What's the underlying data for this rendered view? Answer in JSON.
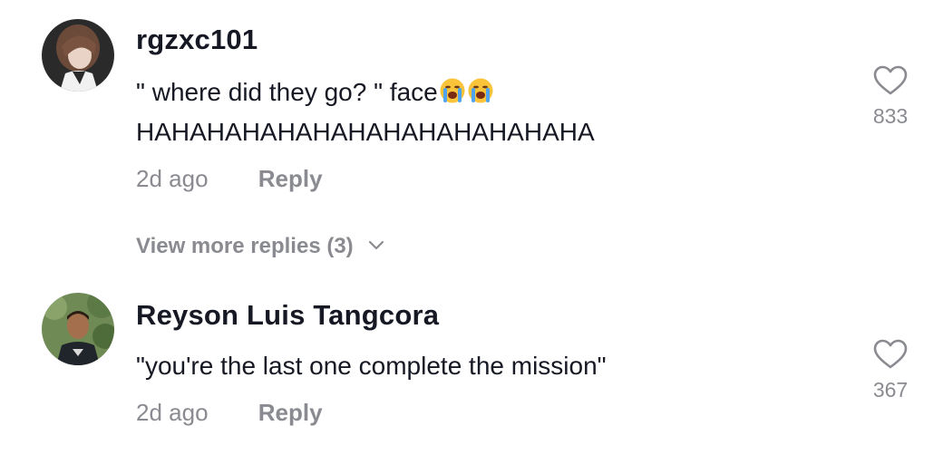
{
  "comments": [
    {
      "username": "rgzxc101",
      "text_line1": "\" where did they go? \" face",
      "text_line2": "HAHAHAHAHAHAHAHAHAHAHAHAHA",
      "emoji": "loudly-crying-face-icon",
      "time": "2d ago",
      "reply_label": "Reply",
      "likes": "833",
      "view_more": "View more replies (3)"
    },
    {
      "username": "Reyson Luis Tangcora",
      "text_line1": "\"you're the last one complete the mission\"",
      "time": "2d ago",
      "reply_label": "Reply",
      "likes": "367"
    }
  ],
  "colors": {
    "primary_text": "#161823",
    "secondary_text": "#8a8b91",
    "background": "#ffffff"
  }
}
